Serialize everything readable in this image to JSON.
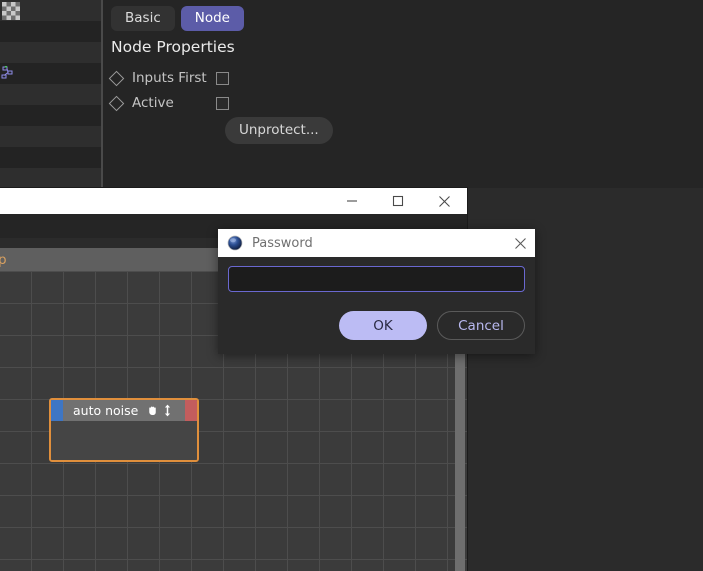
{
  "properties_panel": {
    "tabs": [
      {
        "label": "Basic",
        "active": false
      },
      {
        "label": "Node",
        "active": true
      }
    ],
    "section_title": "Node Properties",
    "rows": [
      {
        "label": "Inputs First",
        "checked": false
      },
      {
        "label": "Active",
        "checked": false
      }
    ],
    "unprotect_label": "Unprotect..."
  },
  "main_window": {
    "titlebar": {
      "minimize_label": "─",
      "maximize_label": "□",
      "close_label": "✕"
    },
    "editor_toolbar": {
      "label": "p"
    },
    "node": {
      "title": "auto noise",
      "hand_icon": "hand-icon",
      "updown_icon": "up-down-arrow-icon",
      "input_port_color": "#3e76c4",
      "output_port_color": "#c35d5d",
      "selection_color": "#e08f3c"
    }
  },
  "password_dialog": {
    "icon": "app-sphere-icon",
    "title": "Password",
    "close_label": "✕",
    "input_value": "",
    "input_placeholder": "",
    "ok_label": "OK",
    "cancel_label": "Cancel",
    "accent_color": "#6a68d0",
    "ok_button_color": "#bcbcf4"
  }
}
